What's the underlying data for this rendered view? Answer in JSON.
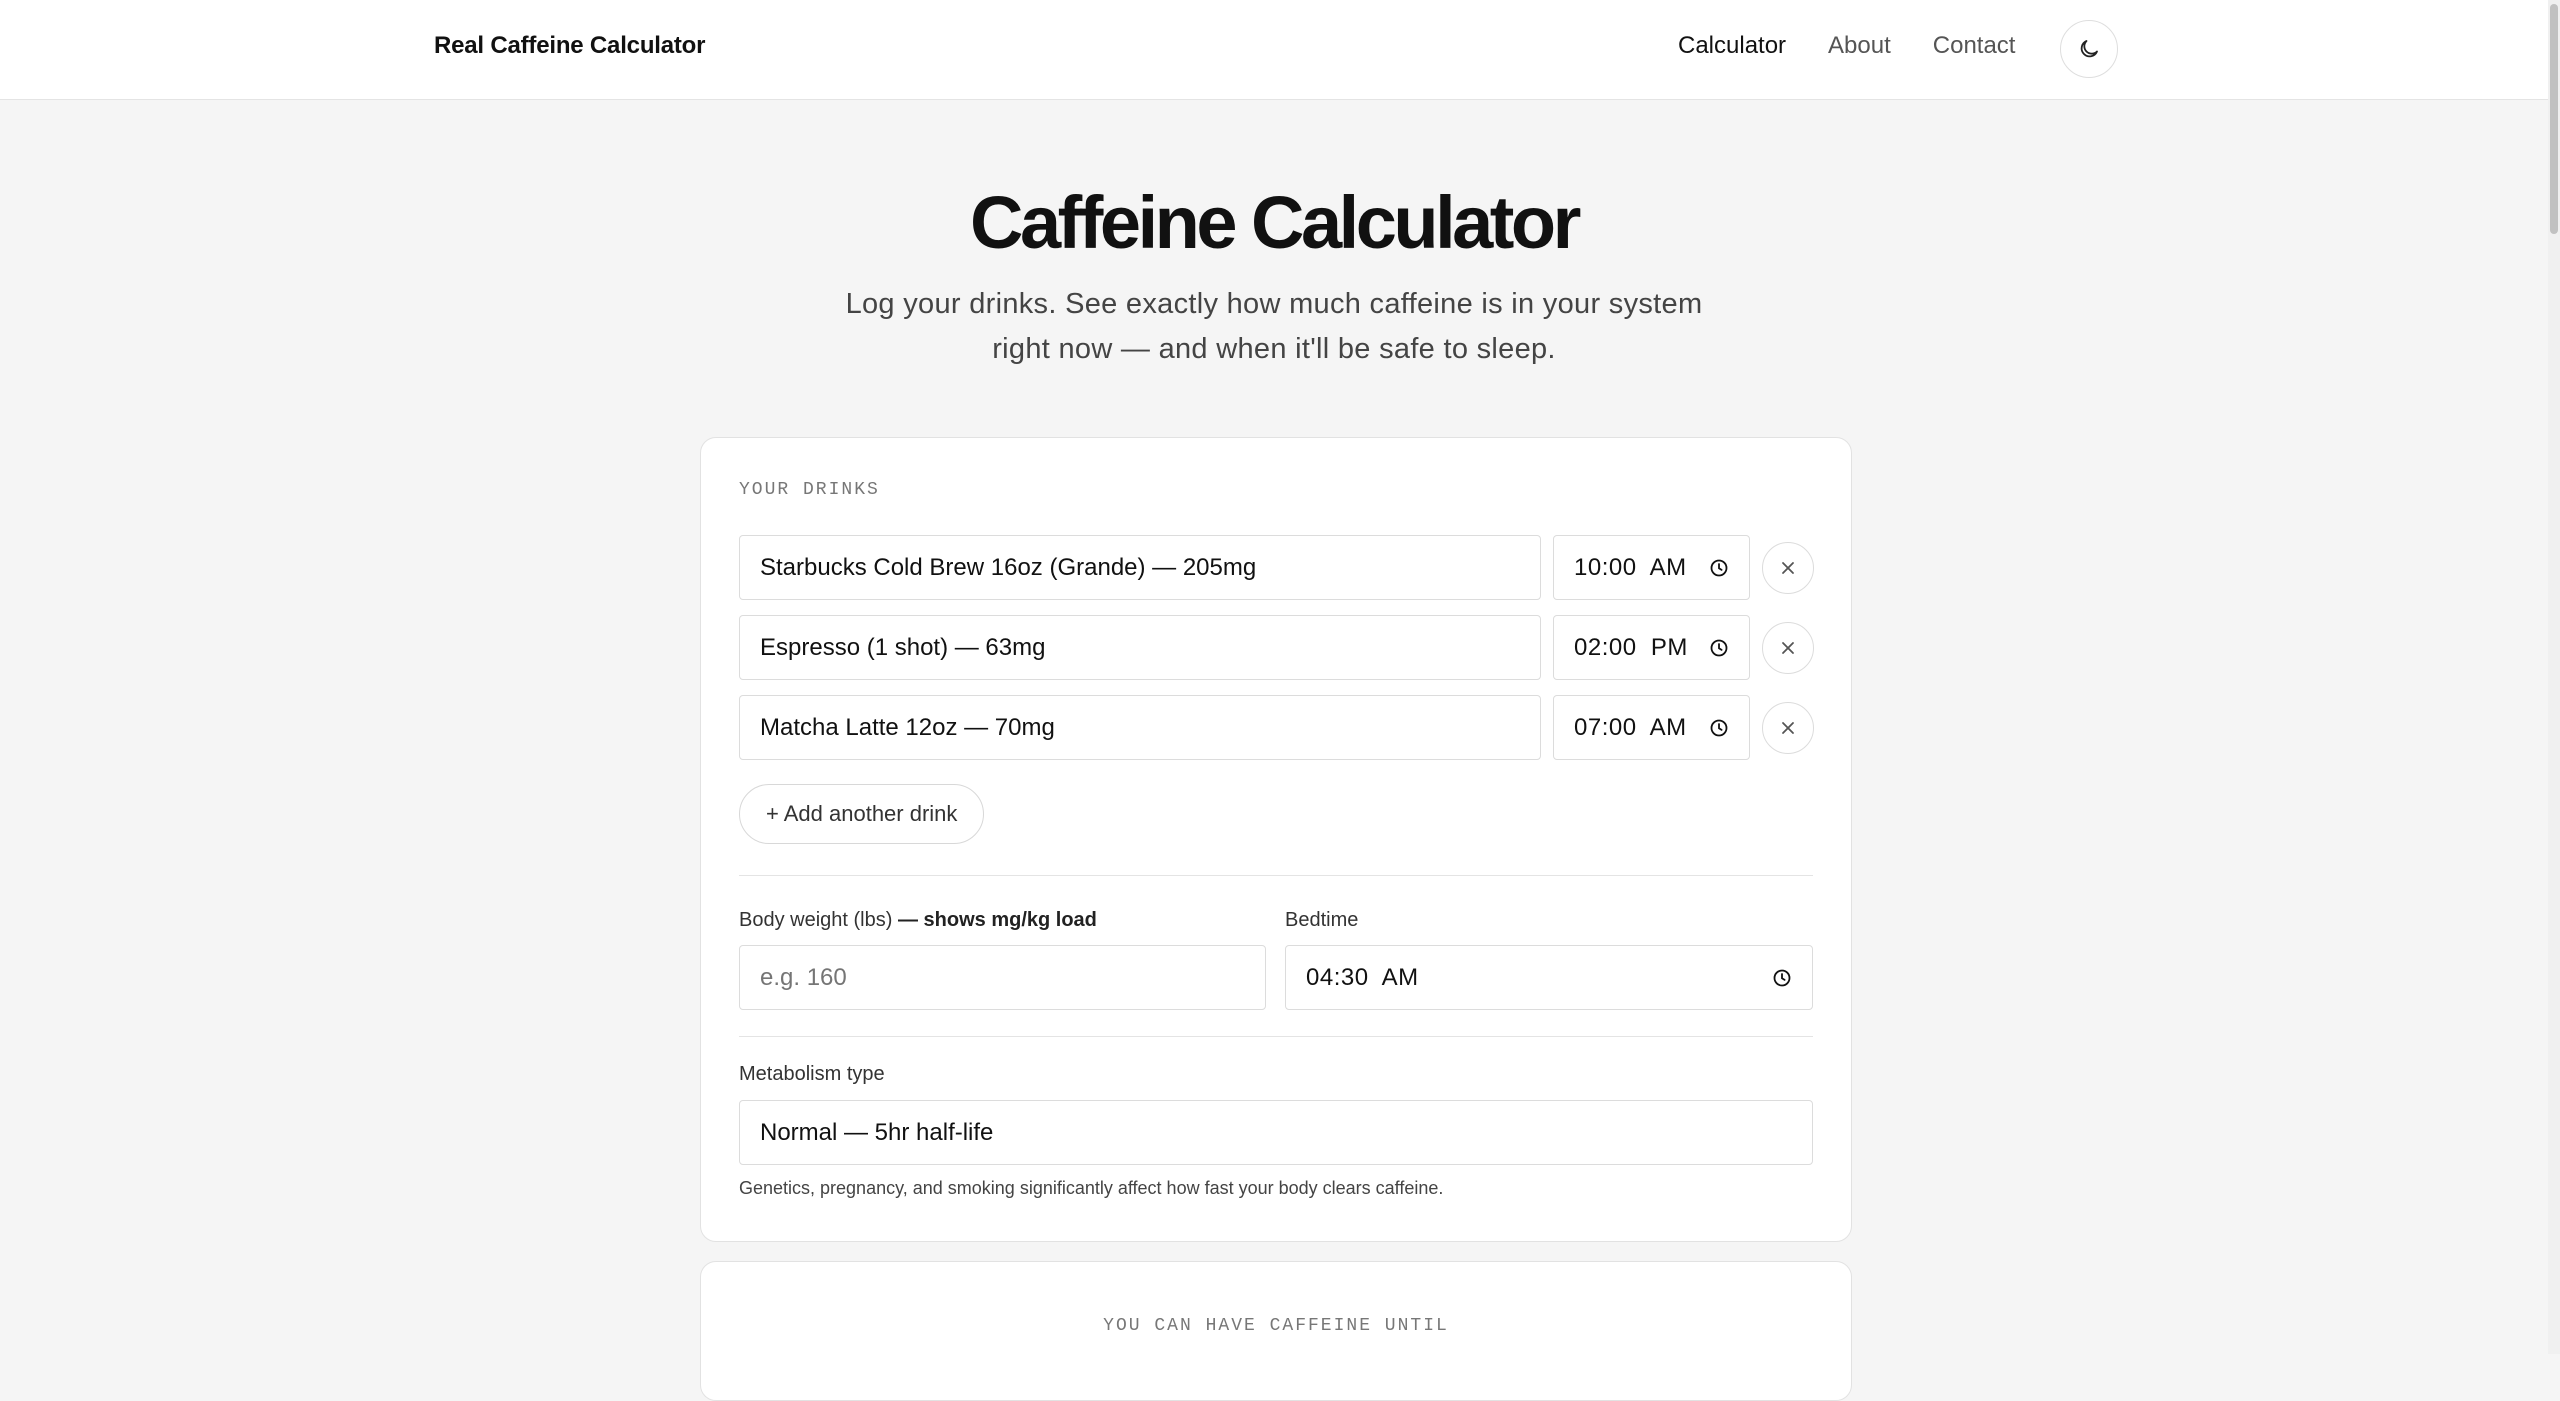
{
  "nav": {
    "brand": "Real Caffeine Calculator",
    "links": [
      "Calculator",
      "About",
      "Contact"
    ],
    "theme_icon": "moon-icon"
  },
  "hero": {
    "title": "Caffeine Calculator",
    "subtitle_line1": "Log your drinks. See exactly how much caffeine is in your system",
    "subtitle_line2": "right now — and when it'll be safe to sleep."
  },
  "drinks": {
    "section_label": "YOUR DRINKS",
    "items": [
      {
        "name": "Starbucks Cold Brew 16oz (Grande) — 205mg",
        "time": "10:00  AM"
      },
      {
        "name": "Espresso (1 shot) — 63mg",
        "time": "02:00  PM"
      },
      {
        "name": "Matcha Latte 12oz — 70mg",
        "time": "07:00  AM"
      }
    ],
    "add_label": "+ Add another drink"
  },
  "settings": {
    "weight_label": "Body weight (lbs)",
    "weight_label_suffix": " — shows mg/kg load",
    "weight_placeholder": "e.g. 160",
    "bedtime_label": "Bedtime",
    "bedtime_value": "04:30  AM",
    "metabolism_label": "Metabolism type",
    "metabolism_value": "Normal — 5hr half-life",
    "helper_text": "Genetics, pregnancy, and smoking significantly affect how fast your body clears caffeine."
  },
  "result": {
    "section_label": "YOU CAN HAVE CAFFEINE UNTIL"
  },
  "colors": {
    "background": "#f5f5f5",
    "card": "#ffffff",
    "border": "#dcdcdc",
    "text": "#111111",
    "muted": "#777777"
  }
}
